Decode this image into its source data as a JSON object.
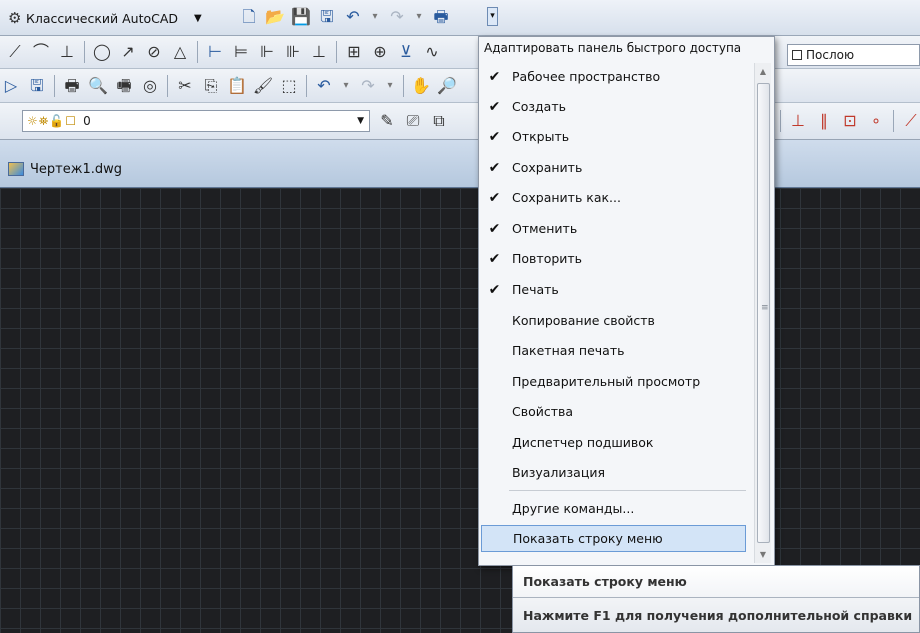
{
  "quick_access": {
    "workspace": "Классический AutoCAD",
    "icons": [
      "new-icon",
      "open-icon",
      "save-icon",
      "save-as-icon",
      "undo-icon",
      "redo-icon",
      "plot-icon"
    ]
  },
  "properties": {
    "color_value": "Послою"
  },
  "layers": {
    "current_layer": "0"
  },
  "document_tab": {
    "label": "Чертеж1.dwg"
  },
  "customize_menu": {
    "header": "Адаптировать панель быстрого доступа",
    "items": [
      {
        "label": "Рабочее пространство",
        "checked": "✔"
      },
      {
        "label": "Создать",
        "checked": "✔"
      },
      {
        "label": "Открыть",
        "checked": "✔"
      },
      {
        "label": "Сохранить",
        "checked": "✔"
      },
      {
        "label": "Сохранить как...",
        "checked": "✔"
      },
      {
        "label": "Отменить",
        "checked": "✔"
      },
      {
        "label": "Повторить",
        "checked": "✔"
      },
      {
        "label": "Печать",
        "checked": "✔"
      },
      {
        "label": "Копирование свойств",
        "checked": ""
      },
      {
        "label": "Пакетная печать",
        "checked": ""
      },
      {
        "label": "Предварительный просмотр",
        "checked": ""
      },
      {
        "label": "Свойства",
        "checked": ""
      },
      {
        "label": "Диспетчер подшивок",
        "checked": ""
      },
      {
        "label": "Визуализация",
        "checked": ""
      }
    ],
    "more_commands": "Другие команды...",
    "show_menu_bar": "Показать строку меню"
  },
  "tooltip": {
    "title": "Показать строку меню",
    "help": "Нажмите F1 для получения дополнительной справки"
  },
  "colors": {
    "canvas_bg": "#1e1f22",
    "grid": "#30353b",
    "highlight": "#d3e4f7",
    "highlight_border": "#6b9bd6"
  }
}
